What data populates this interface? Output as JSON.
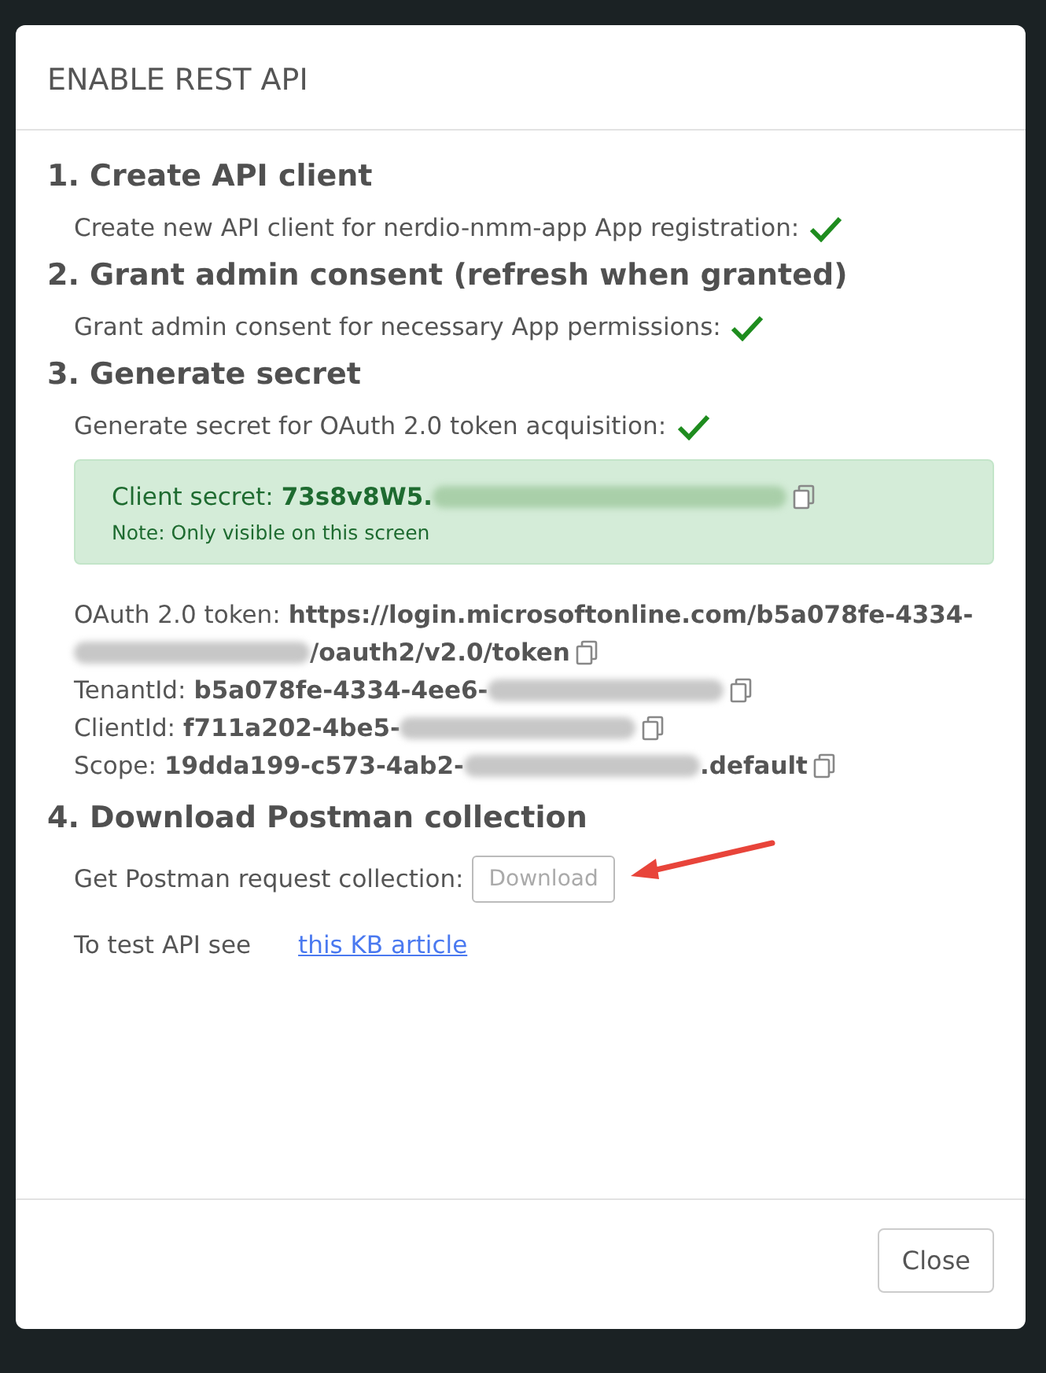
{
  "dialog": {
    "title": "ENABLE REST API",
    "steps": [
      {
        "kind": "status",
        "heading": "1. Create API client",
        "text": "Create new API client for nerdio-nmm-app App registration:",
        "done": true
      },
      {
        "kind": "status",
        "heading": "2. Grant admin consent (refresh when granted)",
        "text": "Grant admin consent for necessary App permissions:",
        "done": true
      },
      {
        "kind": "secret",
        "heading": "3. Generate secret",
        "text": "Generate secret for OAuth 2.0 token acquisition:",
        "done": true,
        "secret": {
          "label": "Client secret:",
          "segments": [
            {
              "kind": "text",
              "text": "73s8v8W5."
            },
            {
              "kind": "redacted"
            }
          ],
          "note": "Note: Only visible on this screen"
        },
        "details": [
          {
            "label": "OAuth 2.0 token:",
            "segments": [
              {
                "kind": "text",
                "text": "https://login.microsoftonline.com/b5a078fe-4334-"
              },
              {
                "kind": "redacted"
              },
              {
                "kind": "text",
                "text": "/oauth2/v2.0/token"
              }
            ]
          },
          {
            "label": "TenantId:",
            "segments": [
              {
                "kind": "text",
                "text": "b5a078fe-4334-4ee6-"
              },
              {
                "kind": "redacted"
              }
            ]
          },
          {
            "label": "ClientId:",
            "segments": [
              {
                "kind": "text",
                "text": "f711a202-4be5-"
              },
              {
                "kind": "redacted"
              }
            ]
          },
          {
            "label": "Scope:",
            "segments": [
              {
                "kind": "text",
                "text": "19dda199-c573-4ab2-"
              },
              {
                "kind": "redacted"
              },
              {
                "kind": "text",
                "text": ".default"
              }
            ]
          }
        ]
      },
      {
        "kind": "download",
        "heading": "4. Download Postman collection",
        "text": "Get Postman request collection:",
        "button": {
          "label": "Download",
          "disabled": true
        },
        "kb": {
          "text": "To test API see",
          "link": "this KB article"
        }
      }
    ],
    "close": "Close"
  }
}
